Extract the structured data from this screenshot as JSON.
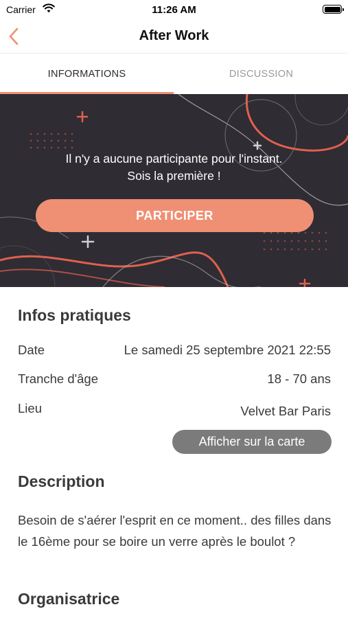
{
  "status_bar": {
    "carrier": "Carrier",
    "time": "11:26 AM"
  },
  "nav": {
    "title": "After Work"
  },
  "tabs": [
    {
      "label": "INFORMATIONS",
      "active": true
    },
    {
      "label": "DISCUSSION",
      "active": false
    }
  ],
  "banner": {
    "message_line1": "Il n'y a aucune participante pour l'instant.",
    "message_line2": "Sois la première !",
    "cta_label": "PARTICIPER"
  },
  "infos": {
    "title": "Infos pratiques",
    "rows": [
      {
        "label": "Date",
        "value": "Le samedi 25 septembre 2021 22:55"
      },
      {
        "label": "Tranche d'âge",
        "value": "18 - 70 ans"
      },
      {
        "label": "Lieu",
        "value": "Velvet Bar Paris"
      }
    ],
    "map_button": "Afficher sur la carte"
  },
  "description": {
    "title": "Description",
    "text": "Besoin de s'aérer l'esprit en ce moment.. des filles dans le 16ème pour se boire un verre après le boulot ?"
  },
  "organizer": {
    "title": "Organisatrice"
  },
  "colors": {
    "accent": "#ef8f74",
    "banner_bg": "#2f2c33",
    "map_button_bg": "#7b7b7b"
  },
  "icons": {
    "back": "chevron-left-icon",
    "wifi": "wifi-icon",
    "battery": "battery-icon"
  }
}
